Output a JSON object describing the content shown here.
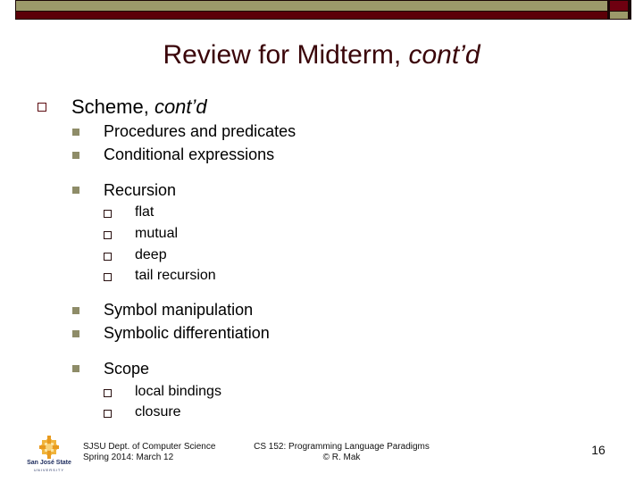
{
  "slide": {
    "title": {
      "main": "Review for Midterm, ",
      "italic": "cont’d"
    },
    "level1": {
      "text": "Scheme, ",
      "italic": "cont’d"
    },
    "items": [
      {
        "label": "Procedures and predicates"
      },
      {
        "label": "Conditional expressions"
      },
      {
        "label": "Recursion",
        "children": [
          "flat",
          "mutual",
          "deep",
          "tail recursion"
        ]
      },
      {
        "label": "Symbol manipulation"
      },
      {
        "label": "Symbolic differentiation"
      },
      {
        "label": "Scope",
        "children": [
          "local bindings",
          "closure"
        ]
      }
    ]
  },
  "footer": {
    "left_line1": "SJSU Dept. of Computer Science",
    "left_line2": "Spring 2014: March 12",
    "center_line1": "CS 152: Programming Language Paradigms",
    "center_line2": "© R. Mak",
    "page_number": "16",
    "logo_text": "San José State",
    "logo_sub": "UNIVERSITY"
  },
  "colors": {
    "title": "#3a0509",
    "bar_olive": "#9c9a6a",
    "bar_maroon": "#5c0008",
    "bullet_level1": "#5c0a10",
    "bullet_level2": "#8e8c68"
  }
}
